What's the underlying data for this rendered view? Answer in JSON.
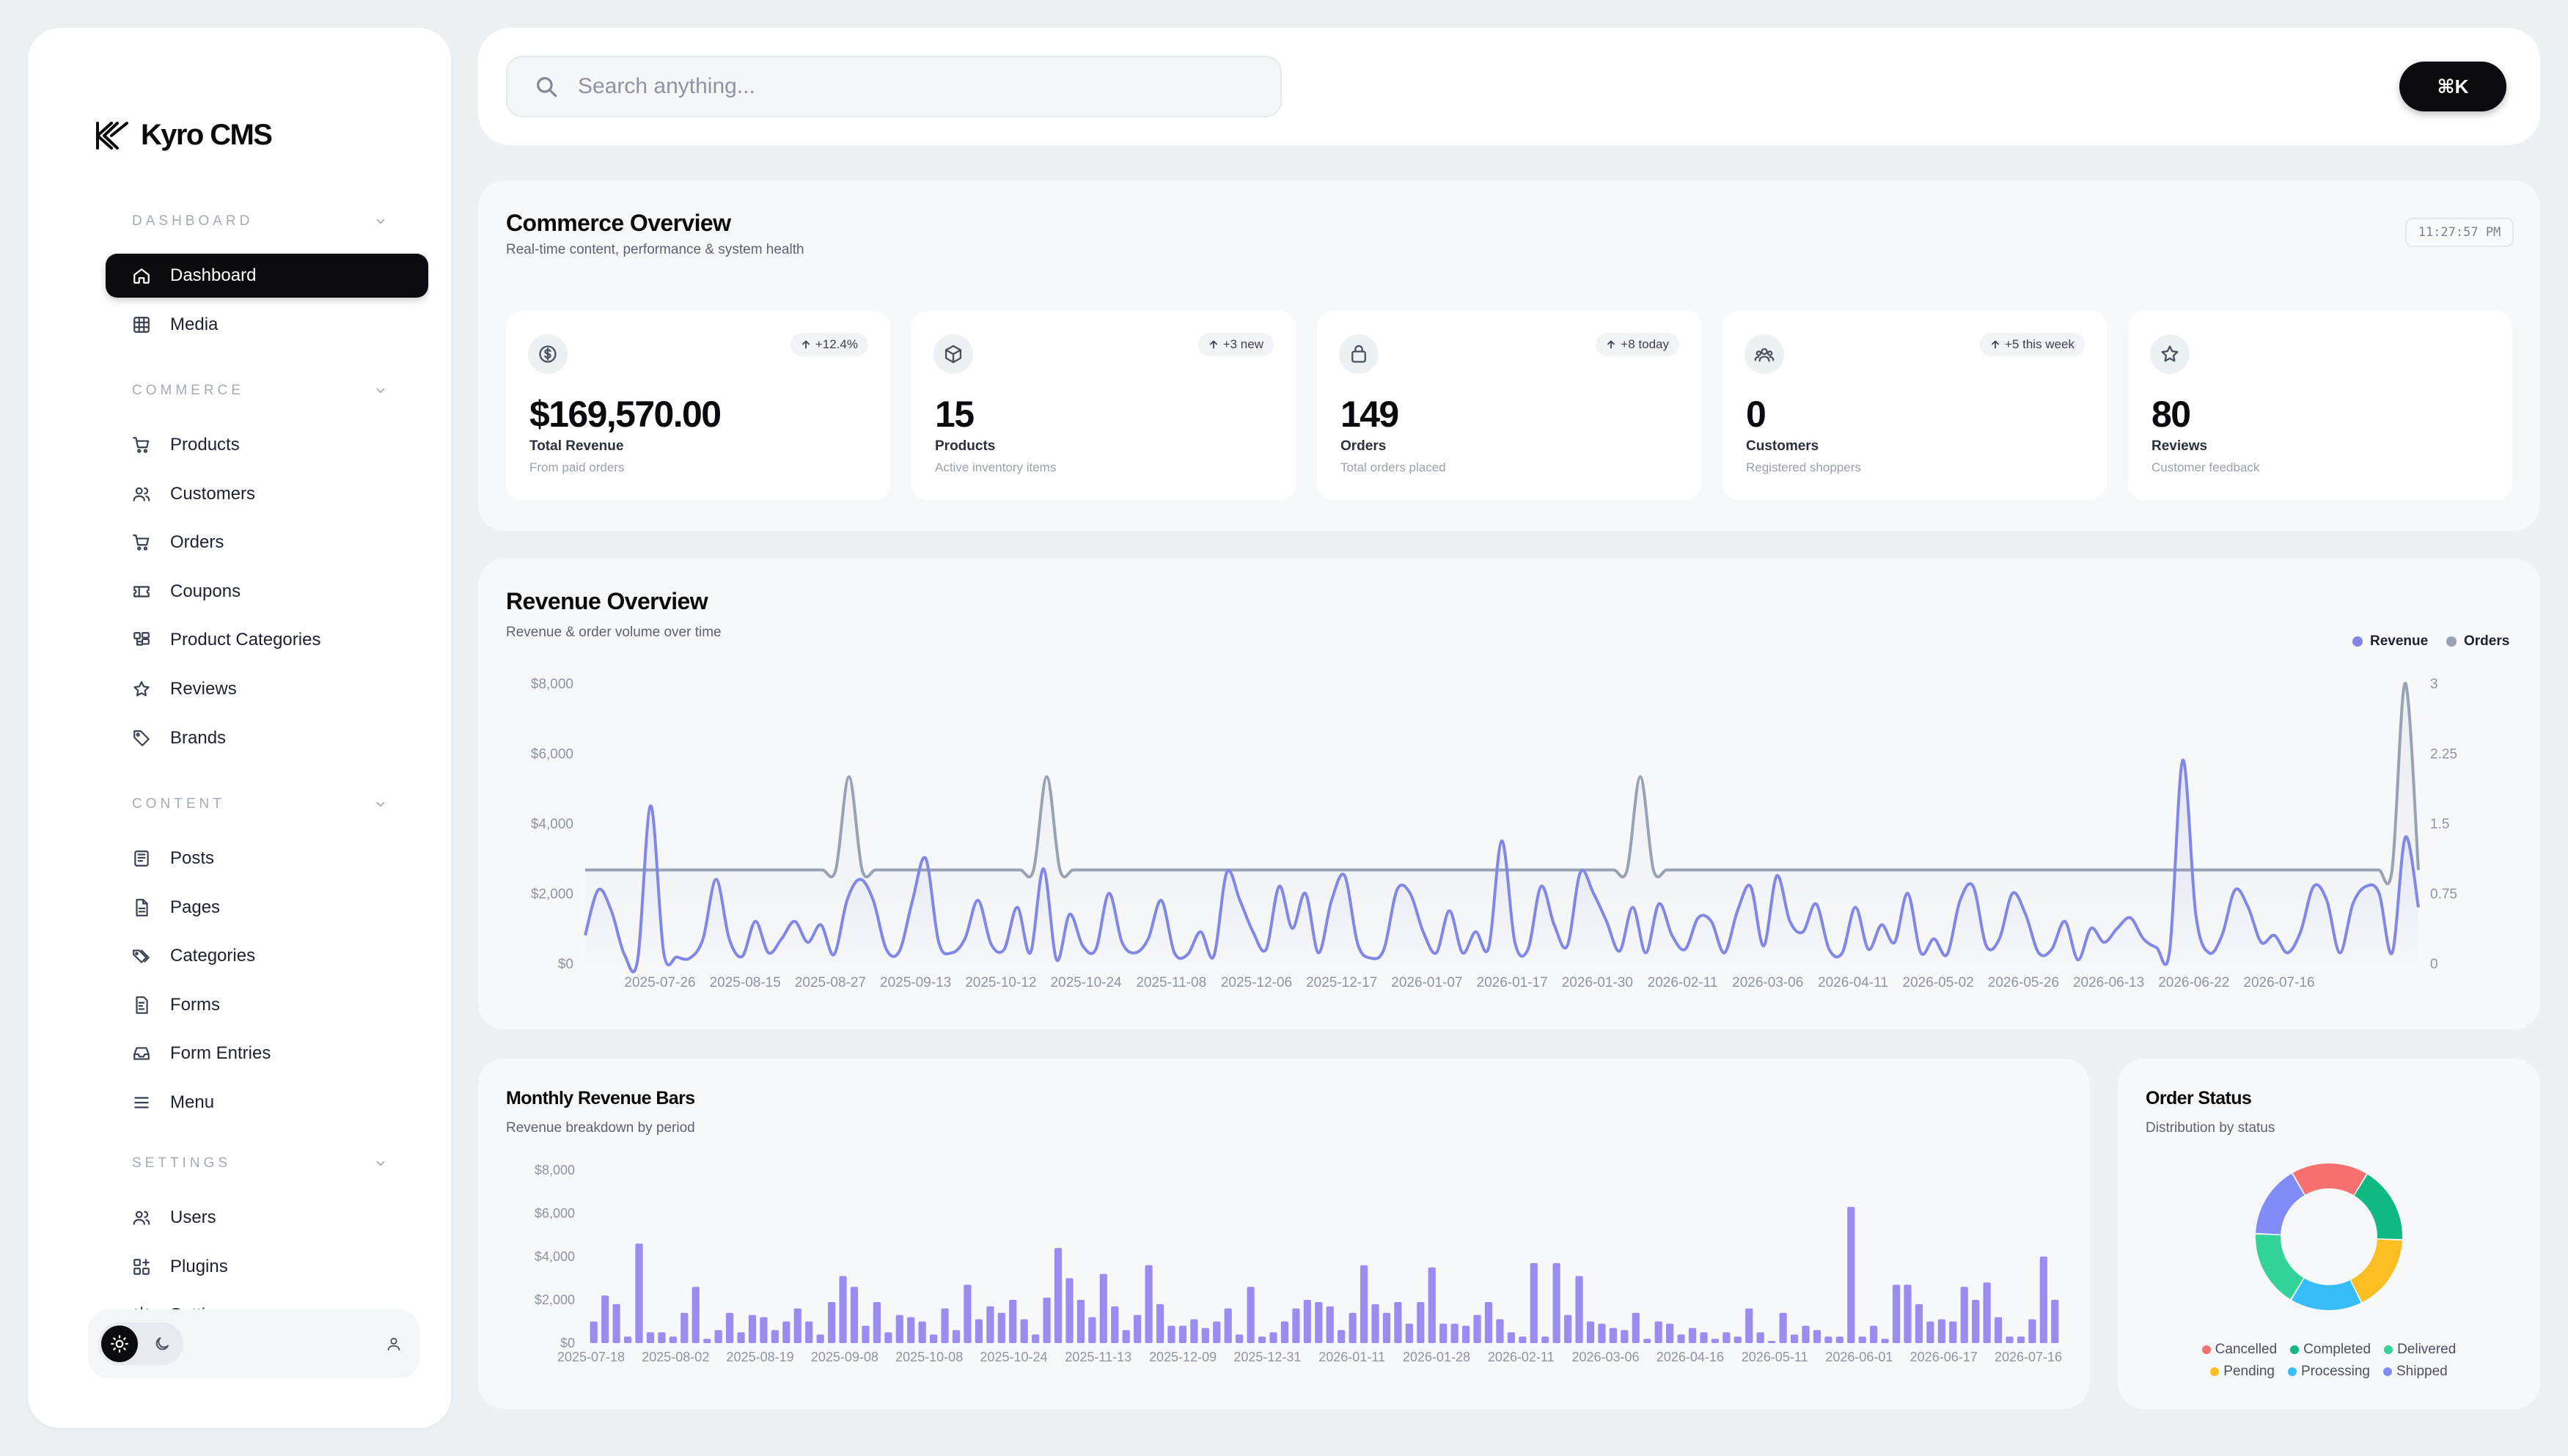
{
  "brand": {
    "name": "Kyro CMS"
  },
  "sidebar": {
    "sections": [
      {
        "label": "DASHBOARD",
        "items": [
          {
            "label": "Dashboard",
            "icon": "home-icon",
            "active": true
          },
          {
            "label": "Media",
            "icon": "image-icon"
          }
        ]
      },
      {
        "label": "COMMERCE",
        "items": [
          {
            "label": "Products",
            "icon": "cart-icon"
          },
          {
            "label": "Customers",
            "icon": "users-icon"
          },
          {
            "label": "Orders",
            "icon": "cart-icon"
          },
          {
            "label": "Coupons",
            "icon": "ticket-icon"
          },
          {
            "label": "Product Categories",
            "icon": "category-icon"
          },
          {
            "label": "Reviews",
            "icon": "star-icon"
          },
          {
            "label": "Brands",
            "icon": "tag-icon"
          }
        ]
      },
      {
        "label": "CONTENT",
        "items": [
          {
            "label": "Posts",
            "icon": "newspaper-icon"
          },
          {
            "label": "Pages",
            "icon": "file-icon"
          },
          {
            "label": "Categories",
            "icon": "tags-icon"
          },
          {
            "label": "Forms",
            "icon": "form-icon"
          },
          {
            "label": "Form Entries",
            "icon": "inbox-icon"
          },
          {
            "label": "Menu",
            "icon": "menu-icon"
          }
        ]
      },
      {
        "label": "SETTINGS",
        "items": [
          {
            "label": "Users",
            "icon": "users-icon"
          },
          {
            "label": "Plugins",
            "icon": "plugin-icon"
          },
          {
            "label": "Settings",
            "icon": "gear-icon"
          }
        ]
      }
    ]
  },
  "search": {
    "placeholder": "Search anything...",
    "shortcut": "⌘K"
  },
  "overview": {
    "title": "Commerce Overview",
    "subtitle": "Real-time content, performance & system health",
    "time": "11:27:57 PM",
    "stats": [
      {
        "icon": "dollar-icon",
        "badge": "+12.4%",
        "value": "$169,570.00",
        "label": "Total Revenue",
        "desc": "From paid orders"
      },
      {
        "icon": "box-icon",
        "badge": "+3 new",
        "value": "15",
        "label": "Products",
        "desc": "Active inventory items"
      },
      {
        "icon": "bag-icon",
        "badge": "+8 today",
        "value": "149",
        "label": "Orders",
        "desc": "Total orders placed"
      },
      {
        "icon": "users-group-icon",
        "badge": "+5 this week",
        "value": "0",
        "label": "Customers",
        "desc": "Registered shoppers"
      },
      {
        "icon": "star-icon",
        "badge": "",
        "value": "80",
        "label": "Reviews",
        "desc": "Customer feedback"
      }
    ]
  },
  "colors": {
    "revenue": "#8286e6",
    "orders": "#98a2b3",
    "bars": "#9b8cf2"
  },
  "chart_data": [
    {
      "type": "line",
      "title": "Revenue Overview",
      "subtitle": "Revenue & order volume over time",
      "legend": [
        "Revenue",
        "Orders"
      ],
      "legend_position": "top-right",
      "y_ticks": [
        "$8,000",
        "$6,000",
        "$4,000",
        "$2,000",
        "$0"
      ],
      "y2_ticks": [
        "3",
        "2.25",
        "1.5",
        "0.75",
        "0"
      ],
      "x_ticks": [
        "2025-07-26",
        "2025-08-15",
        "2025-08-27",
        "2025-09-13",
        "2025-10-12",
        "2025-10-24",
        "2025-11-08",
        "2025-12-06",
        "2025-12-17",
        "2026-01-07",
        "2026-01-17",
        "2026-01-30",
        "2026-02-11",
        "2026-03-06",
        "2026-04-11",
        "2026-05-02",
        "2026-05-26",
        "2026-06-13",
        "2026-06-22",
        "2026-07-16"
      ],
      "ylim": [
        0,
        8000
      ],
      "y2lim": [
        0,
        3
      ],
      "series": [
        {
          "name": "Revenue",
          "axis": "left",
          "values": [
            800,
            2100,
            1500,
            250,
            80,
            4500,
            300,
            180,
            150,
            700,
            2400,
            700,
            200,
            1200,
            300,
            700,
            1200,
            600,
            1100,
            250,
            1800,
            2400,
            1800,
            400,
            350,
            1800,
            3000,
            600,
            300,
            700,
            1800,
            550,
            400,
            1600,
            300,
            2700,
            100,
            1400,
            500,
            400,
            2000,
            600,
            300,
            700,
            1800,
            300,
            250,
            900,
            200,
            2600,
            1800,
            900,
            400,
            2200,
            1000,
            2000,
            300,
            1800,
            2500,
            550,
            150,
            400,
            2100,
            2000,
            900,
            300,
            1500,
            300,
            900,
            450,
            3500,
            600,
            400,
            2200,
            1100,
            500,
            2600,
            2000,
            1200,
            350,
            1600,
            300,
            1700,
            800,
            400,
            1300,
            1200,
            300,
            1500,
            2200,
            500,
            2500,
            1200,
            900,
            1700,
            400,
            300,
            1600,
            400,
            1100,
            600,
            2000,
            300,
            700,
            250,
            1800,
            2200,
            500,
            700,
            2000,
            1400,
            300,
            400,
            1200,
            100,
            1000,
            600,
            1000,
            1300,
            700,
            450,
            350,
            5800,
            1400,
            300,
            800,
            2100,
            1600,
            600,
            800,
            300,
            900,
            2200,
            1800,
            300,
            1700,
            2200,
            2000,
            300,
            3600,
            1600
          ]
        },
        {
          "name": "Orders",
          "axis": "right",
          "values": [
            1,
            1,
            1,
            1,
            1,
            1,
            1,
            1,
            1,
            1,
            1,
            1,
            1,
            1,
            1,
            1,
            1,
            1,
            1,
            1,
            2,
            1,
            1,
            1,
            1,
            1,
            1,
            1,
            1,
            1,
            1,
            1,
            1,
            1,
            1,
            2,
            1,
            1,
            1,
            1,
            1,
            1,
            1,
            1,
            1,
            1,
            1,
            1,
            1,
            1,
            1,
            1,
            1,
            1,
            1,
            1,
            1,
            1,
            1,
            1,
            1,
            1,
            1,
            1,
            1,
            1,
            1,
            1,
            1,
            1,
            1,
            1,
            1,
            1,
            1,
            1,
            1,
            1,
            1,
            1,
            2,
            1,
            1,
            1,
            1,
            1,
            1,
            1,
            1,
            1,
            1,
            1,
            1,
            1,
            1,
            1,
            1,
            1,
            1,
            1,
            1,
            1,
            1,
            1,
            1,
            1,
            1,
            1,
            1,
            1,
            1,
            1,
            1,
            1,
            1,
            1,
            1,
            1,
            1,
            1,
            1,
            1,
            1,
            1,
            1,
            1,
            1,
            1,
            1,
            1,
            1,
            1,
            1,
            1,
            1,
            1,
            1,
            1,
            3,
            1
          ]
        }
      ]
    },
    {
      "type": "bar",
      "title": "Monthly Revenue Bars",
      "subtitle": "Revenue breakdown by period",
      "y_ticks": [
        "$8,000",
        "$6,000",
        "$4,000",
        "$2,000",
        "$0"
      ],
      "x_ticks": [
        "2025-07-18",
        "2025-08-02",
        "2025-08-19",
        "2025-09-08",
        "2025-10-08",
        "2025-10-24",
        "2025-11-13",
        "2025-12-09",
        "2025-12-31",
        "2026-01-11",
        "2026-01-28",
        "2026-02-11",
        "2026-03-06",
        "2026-04-16",
        "2026-05-11",
        "2026-06-01",
        "2026-06-17",
        "2026-07-16"
      ],
      "ylim": [
        0,
        8000
      ],
      "values": [
        1000,
        2200,
        1800,
        300,
        4600,
        500,
        500,
        300,
        1400,
        2600,
        200,
        600,
        1400,
        500,
        1300,
        1200,
        600,
        1000,
        1600,
        1000,
        400,
        1900,
        3100,
        2600,
        800,
        1900,
        500,
        1300,
        1200,
        1000,
        400,
        1600,
        600,
        2700,
        1100,
        1700,
        1400,
        2000,
        1100,
        400,
        2100,
        4400,
        3000,
        2000,
        1200,
        3200,
        1700,
        600,
        1300,
        3600,
        1800,
        800,
        800,
        1100,
        700,
        1000,
        1600,
        400,
        2600,
        300,
        500,
        1000,
        1600,
        2000,
        1900,
        1700,
        600,
        1400,
        3600,
        1800,
        1400,
        1900,
        900,
        1900,
        3500,
        900,
        900,
        800,
        1300,
        1900,
        1100,
        500,
        300,
        3700,
        300,
        3700,
        1300,
        3100,
        1000,
        900,
        700,
        600,
        1400,
        200,
        1000,
        900,
        400,
        700,
        500,
        200,
        500,
        300,
        1600,
        500,
        100,
        1400,
        400,
        800,
        600,
        300,
        300,
        6300,
        300,
        800,
        200,
        2700,
        2700,
        1800,
        1000,
        1100,
        1000,
        2600,
        2000,
        2800,
        1200,
        300,
        300,
        1100,
        4000,
        2000
      ]
    },
    {
      "type": "pie",
      "title": "Order Status",
      "subtitle": "Distribution by status",
      "legend_position": "bottom",
      "slices": [
        {
          "name": "Cancelled",
          "value": 17,
          "color": "#f87171"
        },
        {
          "name": "Completed",
          "value": 17,
          "color": "#10b981"
        },
        {
          "name": "Pending",
          "value": 17,
          "color": "#fbbf24"
        },
        {
          "name": "Processing",
          "value": 16,
          "color": "#38bdf8"
        },
        {
          "name": "Delivered",
          "value": 17,
          "color": "#34d399"
        },
        {
          "name": "Shipped",
          "value": 16,
          "color": "#818cf8"
        }
      ],
      "legend": [
        "Cancelled",
        "Completed",
        "Delivered",
        "Pending",
        "Processing",
        "Shipped"
      ]
    }
  ]
}
